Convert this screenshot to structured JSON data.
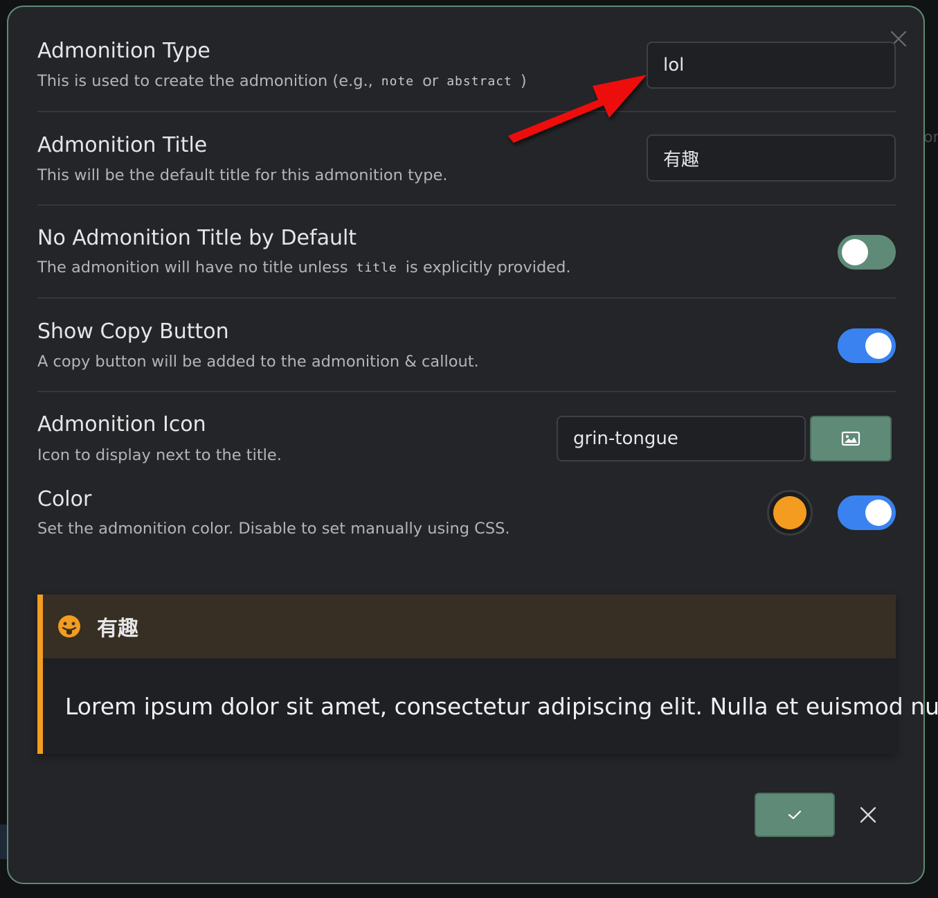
{
  "backdrop_text": "or",
  "settings": {
    "type": {
      "name": "Admonition Type",
      "desc_prefix": "This is used to create the admonition (e.g.,",
      "code1": "note",
      "desc_mid": "or",
      "code2": "abstract",
      "desc_suffix": ")",
      "value": "lol"
    },
    "title": {
      "name": "Admonition Title",
      "desc": "This will be the default title for this admonition type.",
      "value": "有趣"
    },
    "no_title": {
      "name": "No Admonition Title by Default",
      "desc_prefix": "The admonition will have no title unless",
      "code": "title",
      "desc_suffix": "is explicitly provided.",
      "enabled": false
    },
    "copy": {
      "name": "Show Copy Button",
      "desc": "A copy button will be added to the admonition & callout.",
      "enabled": true
    },
    "icon": {
      "name": "Admonition Icon",
      "desc": "Icon to display next to the title.",
      "value": "grin-tongue",
      "button_icon": "image-icon"
    },
    "color": {
      "name": "Color",
      "desc": "Set the admonition color. Disable to set manually using CSS.",
      "value": "#f39c1f",
      "enabled": true
    }
  },
  "preview": {
    "icon": "grin-tongue-icon",
    "title": "有趣",
    "content": "Lorem ipsum dolor sit amet, consectetur adipiscing elit. Nulla et euismod nulla.",
    "accent": "#f39c1f",
    "title_bg": "#372f24"
  },
  "footer": {
    "confirm_icon": "checkmark-icon",
    "cancel_icon": "close-icon"
  },
  "colors": {
    "modal_border": "#5d8a76",
    "toggle_on": "#3a82f0",
    "toggle_off": "#5f8a78",
    "annotation_arrow": "#ee1111"
  }
}
